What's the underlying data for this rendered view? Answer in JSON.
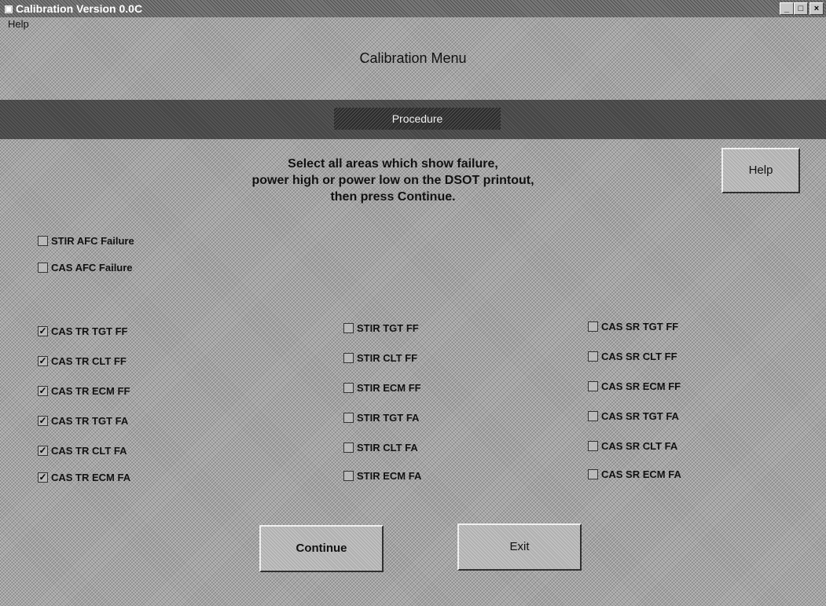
{
  "window": {
    "title": "Calibration Version 0.0C",
    "minimize_glyph": "_",
    "maximize_glyph": "□",
    "close_glyph": "×"
  },
  "menu": {
    "help": "Help"
  },
  "screen_title": "Calibration Menu",
  "section_label": "Procedure",
  "instructions": {
    "line1": "Select all areas which show failure,",
    "line2": "power high or power low on the DSOT printout,",
    "line3": "then press Continue."
  },
  "buttons": {
    "help": "Help",
    "continue": "Continue",
    "exit": "Exit"
  },
  "checkboxes": [
    {
      "label": "STIR AFC Failure",
      "checked": false
    },
    {
      "label": "CAS AFC Failure",
      "checked": false
    },
    {
      "label": "CAS TR TGT FF",
      "checked": true
    },
    {
      "label": "CAS TR CLT FF",
      "checked": true
    },
    {
      "label": "CAS TR ECM FF",
      "checked": true
    },
    {
      "label": "CAS TR TGT FA",
      "checked": true
    },
    {
      "label": "CAS TR CLT FA",
      "checked": true
    },
    {
      "label": "CAS TR ECM FA",
      "checked": true
    },
    {
      "label": "STIR TGT FF",
      "checked": false
    },
    {
      "label": "STIR CLT FF",
      "checked": false
    },
    {
      "label": "STIR ECM FF",
      "checked": false
    },
    {
      "label": "STIR TGT FA",
      "checked": false
    },
    {
      "label": "STIR CLT FA",
      "checked": false
    },
    {
      "label": "STIR ECM FA",
      "checked": false
    },
    {
      "label": "CAS SR TGT FF",
      "checked": false
    },
    {
      "label": "CAS SR CLT FF",
      "checked": false
    },
    {
      "label": "CAS SR ECM FF",
      "checked": false
    },
    {
      "label": "CAS SR TGT FA",
      "checked": false
    },
    {
      "label": "CAS SR CLT FA",
      "checked": false
    },
    {
      "label": "CAS SR ECM FA",
      "checked": false
    }
  ]
}
